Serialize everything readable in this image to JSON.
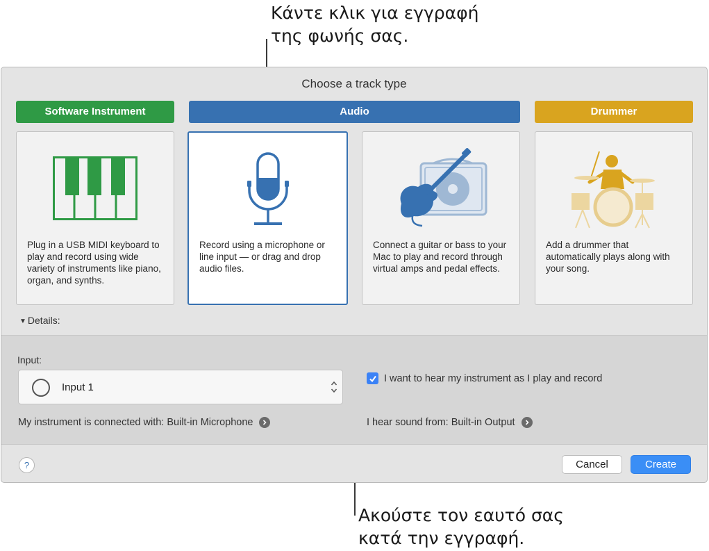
{
  "callouts": {
    "top_line1": "Κάντε κλικ για εγγραφή",
    "top_line2": "της φωνής σας.",
    "bottom_line1": "Ακούστε τον εαυτό σας",
    "bottom_line2": "κατά την εγγραφή."
  },
  "dialog": {
    "title": "Choose a track type",
    "categories": {
      "software": "Software Instrument",
      "audio": "Audio",
      "drummer": "Drummer"
    },
    "cards": [
      {
        "desc": "Plug in a USB MIDI keyboard to play and record using wide variety of instruments like piano, organ, and synths.",
        "icon": "piano-keys-icon"
      },
      {
        "desc": "Record using a microphone or line input — or drag and drop audio files.",
        "icon": "microphone-icon",
        "selected": true
      },
      {
        "desc": "Connect a guitar or bass to your Mac to play and record through virtual amps and pedal effects.",
        "icon": "guitar-amp-icon"
      },
      {
        "desc": "Add a drummer that automatically plays along with your song.",
        "icon": "drummer-icon"
      }
    ],
    "details_label": "Details:",
    "details": {
      "input_label": "Input:",
      "input_value": "Input 1",
      "hear_checkbox_label": "I want to hear my instrument as I play and record",
      "hear_checked": true,
      "connected_with": "My instrument is connected with: Built-in Microphone",
      "hear_from": "I hear sound from: Built-in Output"
    },
    "buttons": {
      "help": "?",
      "cancel": "Cancel",
      "create": "Create"
    }
  },
  "colors": {
    "software": "#2f9a45",
    "audio": "#3771b1",
    "drummer": "#d9a41f",
    "primary_button": "#3a8ef6"
  }
}
